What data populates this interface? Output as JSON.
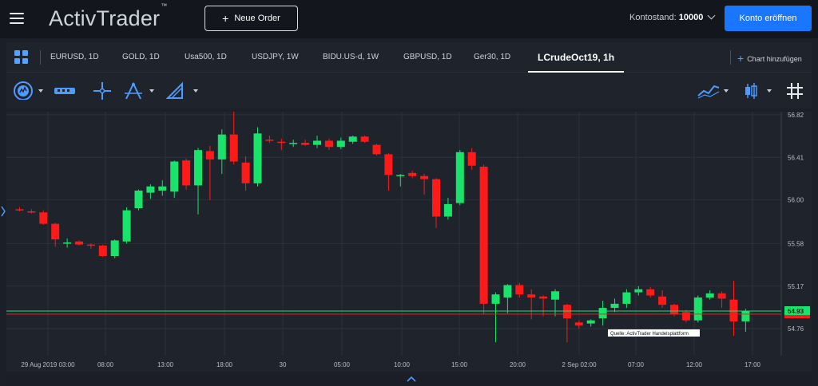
{
  "header": {
    "logo_text": "ActivTrader",
    "logo_tm": "™",
    "new_order_label": "Neue Order",
    "balance_label": "Kontostand:",
    "balance_value": "10000",
    "open_account_label": "Konto eröffnen"
  },
  "tabs": [
    {
      "label": "EURUSD, 1D"
    },
    {
      "label": "GOLD, 1D"
    },
    {
      "label": "Usa500, 1D"
    },
    {
      "label": "USDJPY, 1W"
    },
    {
      "label": "BIDU.US-d, 1W"
    },
    {
      "label": "GBPUSD, 1D"
    },
    {
      "label": "Ger30, 1D"
    },
    {
      "label": "LCrudeOct19, 1h"
    }
  ],
  "active_tab": "LCrudeOct19, 1h",
  "add_chart_label": "Chart hinzufügen",
  "toolbar_icons": [
    "indicators-icon",
    "ruler-icon",
    "crosshair-icon",
    "fibonacci-icon",
    "drawing-icon",
    "chart-type-line-icon",
    "candlestick-icon",
    "grid-toggle-icon"
  ],
  "colors": {
    "bull": "#19e36b",
    "bear": "#ff1a1a",
    "accent": "#1a75ff",
    "bid_line": "#19e36b",
    "ask_line": "#ff1a1a"
  },
  "chart_data": {
    "type": "candlestick",
    "symbol": "LCrudeOct19",
    "timeframe": "1h",
    "y_ticks": [
      "56.82",
      "56.41",
      "56.00",
      "55.58",
      "55.17",
      "54.76"
    ],
    "ylim": [
      54.5,
      56.85
    ],
    "x_ticks": [
      "29 Aug 2019 03:00",
      "08:00",
      "13:00",
      "18:00",
      "30",
      "05:00",
      "10:00",
      "15:00",
      "20:00",
      "2 Sep 02:00",
      "07:00",
      "12:00",
      "17:00"
    ],
    "current_price_green": "54.93",
    "current_price_red": "54.90",
    "source_label": "Quelle: ActivTrader Handelsplattform",
    "candles": [
      {
        "o": 55.91,
        "h": 55.93,
        "l": 55.89,
        "c": 55.9
      },
      {
        "o": 55.89,
        "h": 55.91,
        "l": 55.87,
        "c": 55.88
      },
      {
        "o": 55.88,
        "h": 55.9,
        "l": 55.76,
        "c": 55.77
      },
      {
        "o": 55.77,
        "h": 55.78,
        "l": 55.55,
        "c": 55.62
      },
      {
        "o": 55.58,
        "h": 55.63,
        "l": 55.54,
        "c": 55.59
      },
      {
        "o": 55.6,
        "h": 55.61,
        "l": 55.56,
        "c": 55.57
      },
      {
        "o": 55.57,
        "h": 55.58,
        "l": 55.53,
        "c": 55.56
      },
      {
        "o": 55.56,
        "h": 55.57,
        "l": 55.45,
        "c": 55.46
      },
      {
        "o": 55.46,
        "h": 55.62,
        "l": 55.44,
        "c": 55.61
      },
      {
        "o": 55.6,
        "h": 55.93,
        "l": 55.58,
        "c": 55.9
      },
      {
        "o": 55.92,
        "h": 56.1,
        "l": 55.9,
        "c": 56.09
      },
      {
        "o": 56.07,
        "h": 56.15,
        "l": 56.01,
        "c": 56.13
      },
      {
        "o": 56.09,
        "h": 56.19,
        "l": 56.04,
        "c": 56.13
      },
      {
        "o": 56.08,
        "h": 56.38,
        "l": 56.02,
        "c": 56.37
      },
      {
        "o": 56.38,
        "h": 56.4,
        "l": 56.1,
        "c": 56.14
      },
      {
        "o": 56.14,
        "h": 56.5,
        "l": 55.86,
        "c": 56.48
      },
      {
        "o": 56.47,
        "h": 56.52,
        "l": 56.0,
        "c": 56.39
      },
      {
        "o": 56.39,
        "h": 56.68,
        "l": 56.25,
        "c": 56.63
      },
      {
        "o": 56.63,
        "h": 56.86,
        "l": 56.34,
        "c": 56.37
      },
      {
        "o": 56.36,
        "h": 56.42,
        "l": 56.09,
        "c": 56.16
      },
      {
        "o": 56.16,
        "h": 56.7,
        "l": 56.13,
        "c": 56.64
      },
      {
        "o": 56.58,
        "h": 56.62,
        "l": 56.55,
        "c": 56.57
      },
      {
        "o": 56.56,
        "h": 56.59,
        "l": 56.48,
        "c": 56.55
      },
      {
        "o": 56.55,
        "h": 56.58,
        "l": 56.51,
        "c": 56.55
      },
      {
        "o": 56.55,
        "h": 56.58,
        "l": 56.52,
        "c": 56.53
      },
      {
        "o": 56.53,
        "h": 56.62,
        "l": 56.5,
        "c": 56.57
      },
      {
        "o": 56.57,
        "h": 56.59,
        "l": 56.48,
        "c": 56.51
      },
      {
        "o": 56.51,
        "h": 56.6,
        "l": 56.49,
        "c": 56.57
      },
      {
        "o": 56.56,
        "h": 56.62,
        "l": 56.54,
        "c": 56.61
      },
      {
        "o": 56.61,
        "h": 56.62,
        "l": 56.55,
        "c": 56.56
      },
      {
        "o": 56.53,
        "h": 56.54,
        "l": 56.43,
        "c": 56.44
      },
      {
        "o": 56.44,
        "h": 56.45,
        "l": 56.09,
        "c": 56.24
      },
      {
        "o": 56.24,
        "h": 56.25,
        "l": 56.13,
        "c": 56.24
      },
      {
        "o": 56.26,
        "h": 56.28,
        "l": 56.21,
        "c": 56.23
      },
      {
        "o": 56.23,
        "h": 56.25,
        "l": 56.05,
        "c": 56.2
      },
      {
        "o": 56.2,
        "h": 56.21,
        "l": 55.73,
        "c": 55.84
      },
      {
        "o": 55.84,
        "h": 56.02,
        "l": 55.81,
        "c": 55.96
      },
      {
        "o": 55.97,
        "h": 56.48,
        "l": 55.95,
        "c": 56.46
      },
      {
        "o": 56.46,
        "h": 56.5,
        "l": 56.29,
        "c": 56.33
      },
      {
        "o": 56.32,
        "h": 56.34,
        "l": 54.9,
        "c": 55.0
      },
      {
        "o": 55.0,
        "h": 55.11,
        "l": 54.63,
        "c": 55.09
      },
      {
        "o": 55.06,
        "h": 55.19,
        "l": 54.91,
        "c": 55.18
      },
      {
        "o": 55.18,
        "h": 55.2,
        "l": 55.06,
        "c": 55.09
      },
      {
        "o": 55.09,
        "h": 55.14,
        "l": 54.85,
        "c": 55.06
      },
      {
        "o": 55.07,
        "h": 55.08,
        "l": 54.88,
        "c": 55.05
      },
      {
        "o": 55.04,
        "h": 55.14,
        "l": 54.88,
        "c": 55.12
      },
      {
        "o": 54.99,
        "h": 55.0,
        "l": 54.63,
        "c": 54.86
      },
      {
        "o": 54.82,
        "h": 54.84,
        "l": 54.76,
        "c": 54.79
      },
      {
        "o": 54.81,
        "h": 54.85,
        "l": 54.78,
        "c": 54.84
      },
      {
        "o": 54.86,
        "h": 55.03,
        "l": 54.79,
        "c": 54.96
      },
      {
        "o": 54.96,
        "h": 55.05,
        "l": 54.92,
        "c": 55.0
      },
      {
        "o": 55.0,
        "h": 55.14,
        "l": 54.96,
        "c": 55.11
      },
      {
        "o": 55.11,
        "h": 55.17,
        "l": 55.08,
        "c": 55.14
      },
      {
        "o": 55.14,
        "h": 55.16,
        "l": 55.06,
        "c": 55.08
      },
      {
        "o": 55.07,
        "h": 55.13,
        "l": 54.96,
        "c": 54.99
      },
      {
        "o": 54.99,
        "h": 55.0,
        "l": 54.88,
        "c": 54.9
      },
      {
        "o": 54.92,
        "h": 54.94,
        "l": 54.82,
        "c": 54.84
      },
      {
        "o": 54.84,
        "h": 55.08,
        "l": 54.82,
        "c": 55.06
      },
      {
        "o": 55.06,
        "h": 55.13,
        "l": 55.04,
        "c": 55.1
      },
      {
        "o": 55.1,
        "h": 55.12,
        "l": 54.96,
        "c": 55.05
      },
      {
        "o": 55.04,
        "h": 55.22,
        "l": 54.69,
        "c": 54.83
      },
      {
        "o": 54.83,
        "h": 54.95,
        "l": 54.73,
        "c": 54.93
      }
    ]
  }
}
